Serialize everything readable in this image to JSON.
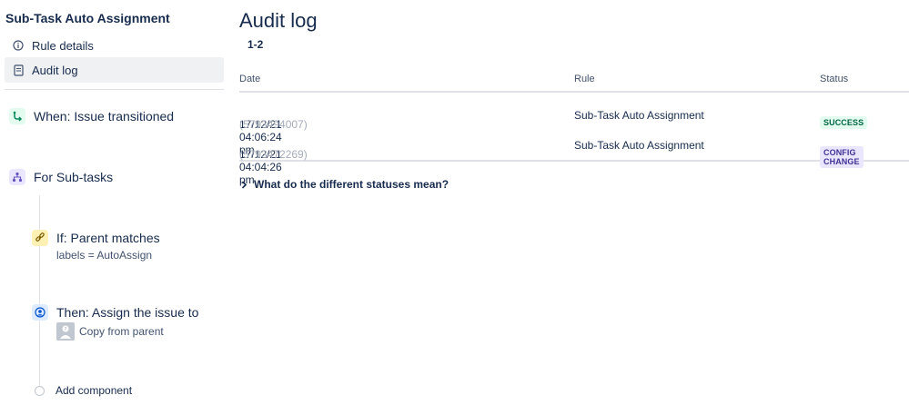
{
  "sidebar": {
    "rule_title": "Sub-Task Auto Assignment",
    "nav": [
      {
        "label": "Rule details",
        "icon": "info-icon"
      },
      {
        "label": "Audit log",
        "icon": "document-icon",
        "active": true
      }
    ],
    "components": {
      "trigger": {
        "title": "When: Issue transitioned",
        "icon": "branch-arrow-icon",
        "color": "#00875a"
      },
      "branch": {
        "title": "For Sub-tasks",
        "icon": "hierarchy-icon",
        "color": "#6554c0"
      },
      "condition": {
        "title": "If: Parent matches",
        "subtitle": "labels = AutoAssign",
        "icon": "link-icon",
        "color": "#ff8b00"
      },
      "action": {
        "title": "Then: Assign the issue to",
        "subtitle": "Copy from parent",
        "icon": "person-circle-icon",
        "color": "#0052cc"
      }
    },
    "add_component_label": "Add component"
  },
  "main": {
    "title": "Audit log",
    "range": "1-2",
    "columns": {
      "date": "Date",
      "rule": "Rule",
      "status": "Status"
    },
    "rows": [
      {
        "date": "17/12/21 04:06:24 pm",
        "id": "(5793494007)",
        "rule": "Sub-Task Auto Assignment",
        "status": "SUCCESS",
        "status_color": "#006644"
      },
      {
        "date": "17/12/21 04:04:26 pm",
        "id": "(5793472269)",
        "rule": "Sub-Task Auto Assignment",
        "status": "CONFIG CHANGE",
        "status_color": "#403294"
      }
    ],
    "expander_label": "What do the different statuses mean?"
  }
}
